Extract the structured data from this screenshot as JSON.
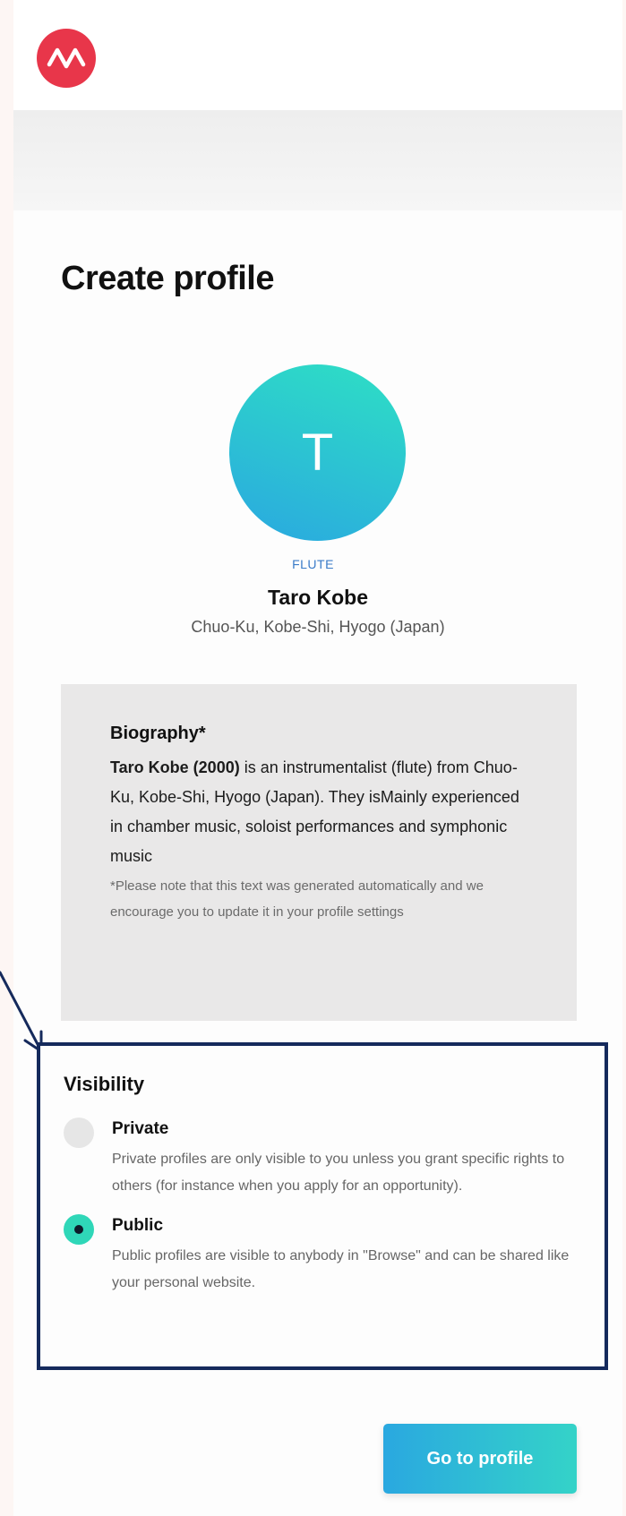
{
  "header": {
    "logo_icon": "waveform-icon"
  },
  "page": {
    "title": "Create profile"
  },
  "profile": {
    "avatar_letter": "T",
    "instrument": "FLUTE",
    "name": "Taro Kobe",
    "location": "Chuo-Ku, Kobe-Shi, Hyogo (Japan)"
  },
  "biography": {
    "title": "Biography*",
    "name_year": "Taro Kobe (2000)",
    "text": " is an instrumentalist (flute) from Chuo-Ku, Kobe-Shi, Hyogo (Japan). They isMainly experienced in chamber music, soloist performances and symphonic music",
    "note": "*Please note that this text was generated automatically and we encourage you to update it in your profile settings"
  },
  "visibility": {
    "title": "Visibility",
    "selected": "public",
    "options": [
      {
        "label": "Private",
        "description": "Private profiles are only visible to you unless you grant specific rights to others (for instance when you apply for an opportunity)."
      },
      {
        "label": "Public",
        "description": "Public profiles are visible to anybody in \"Browse\" and can be shared like your personal website."
      }
    ]
  },
  "actions": {
    "go_to_profile": "Go to profile"
  },
  "colors": {
    "brand_red": "#e8364a",
    "accent_teal": "#2fd7b8",
    "accent_blue": "#2aa8e0",
    "highlight_border": "#152a5c"
  }
}
